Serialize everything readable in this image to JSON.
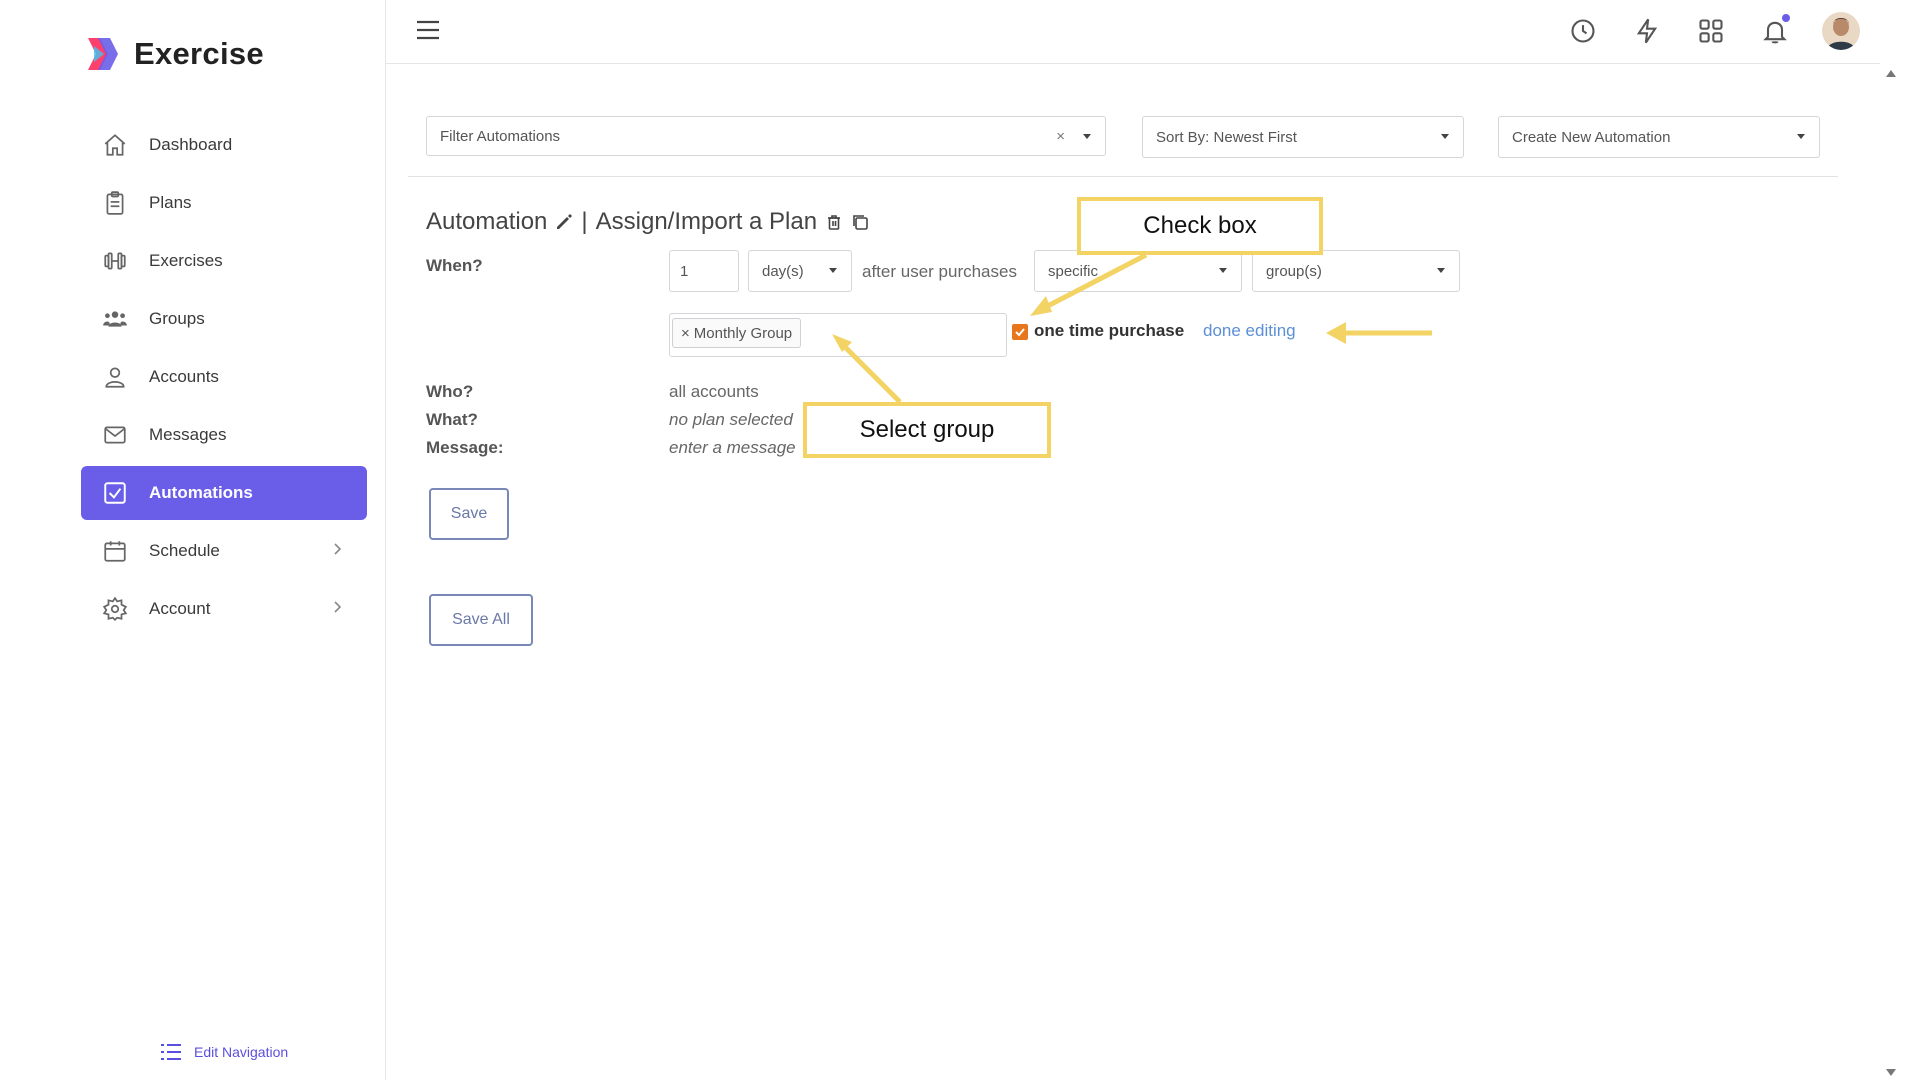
{
  "app": {
    "brand_name": "Exercise",
    "accent_color": "#6a5ee8"
  },
  "sidebar": {
    "items": [
      {
        "label": "Dashboard",
        "icon": "home-icon"
      },
      {
        "label": "Plans",
        "icon": "clipboard-icon"
      },
      {
        "label": "Exercises",
        "icon": "dumbbell-icon"
      },
      {
        "label": "Groups",
        "icon": "users-icon"
      },
      {
        "label": "Accounts",
        "icon": "user-icon"
      },
      {
        "label": "Messages",
        "icon": "mail-icon"
      },
      {
        "label": "Automations",
        "icon": "checkbox-icon",
        "active": true
      },
      {
        "label": "Schedule",
        "icon": "calendar-icon",
        "has_submenu": true
      },
      {
        "label": "Account",
        "icon": "gear-icon",
        "has_submenu": true
      }
    ],
    "edit_navigation_label": "Edit Navigation"
  },
  "topbar": {
    "icons": [
      "menu-icon",
      "clock-icon",
      "lightning-icon",
      "apps-grid-icon",
      "bell-icon",
      "avatar"
    ],
    "notification_dot_color": "#6a5ee8"
  },
  "filters": {
    "filter_placeholder": "Filter Automations",
    "clear_symbol": "×",
    "sort_value": "Sort By: Newest First",
    "create_value": "Create New Automation"
  },
  "automation": {
    "title_prefix": "Automation",
    "title_separator": "|",
    "title_name": "Assign/Import a Plan",
    "when_label": "When?",
    "when_amount": "1",
    "when_unit": "day(s)",
    "after_text": "after user purchases",
    "scope_value": "specific",
    "target_value": "group(s)",
    "selected_group": "Monthly Group",
    "tag_remove_symbol": "×",
    "one_time_purchase_label": "one time purchase",
    "one_time_purchase_checked": true,
    "done_editing_label": "done editing",
    "who_label": "Who?",
    "who_value": "all accounts",
    "what_label": "What?",
    "what_value": "no plan selected",
    "message_label": "Message:",
    "message_value": "enter a message",
    "save_label": "Save",
    "save_all_label": "Save All"
  },
  "annotations": {
    "check_box_callout": "Check box",
    "select_group_callout": "Select group",
    "highlight_color": "#f2d364"
  }
}
